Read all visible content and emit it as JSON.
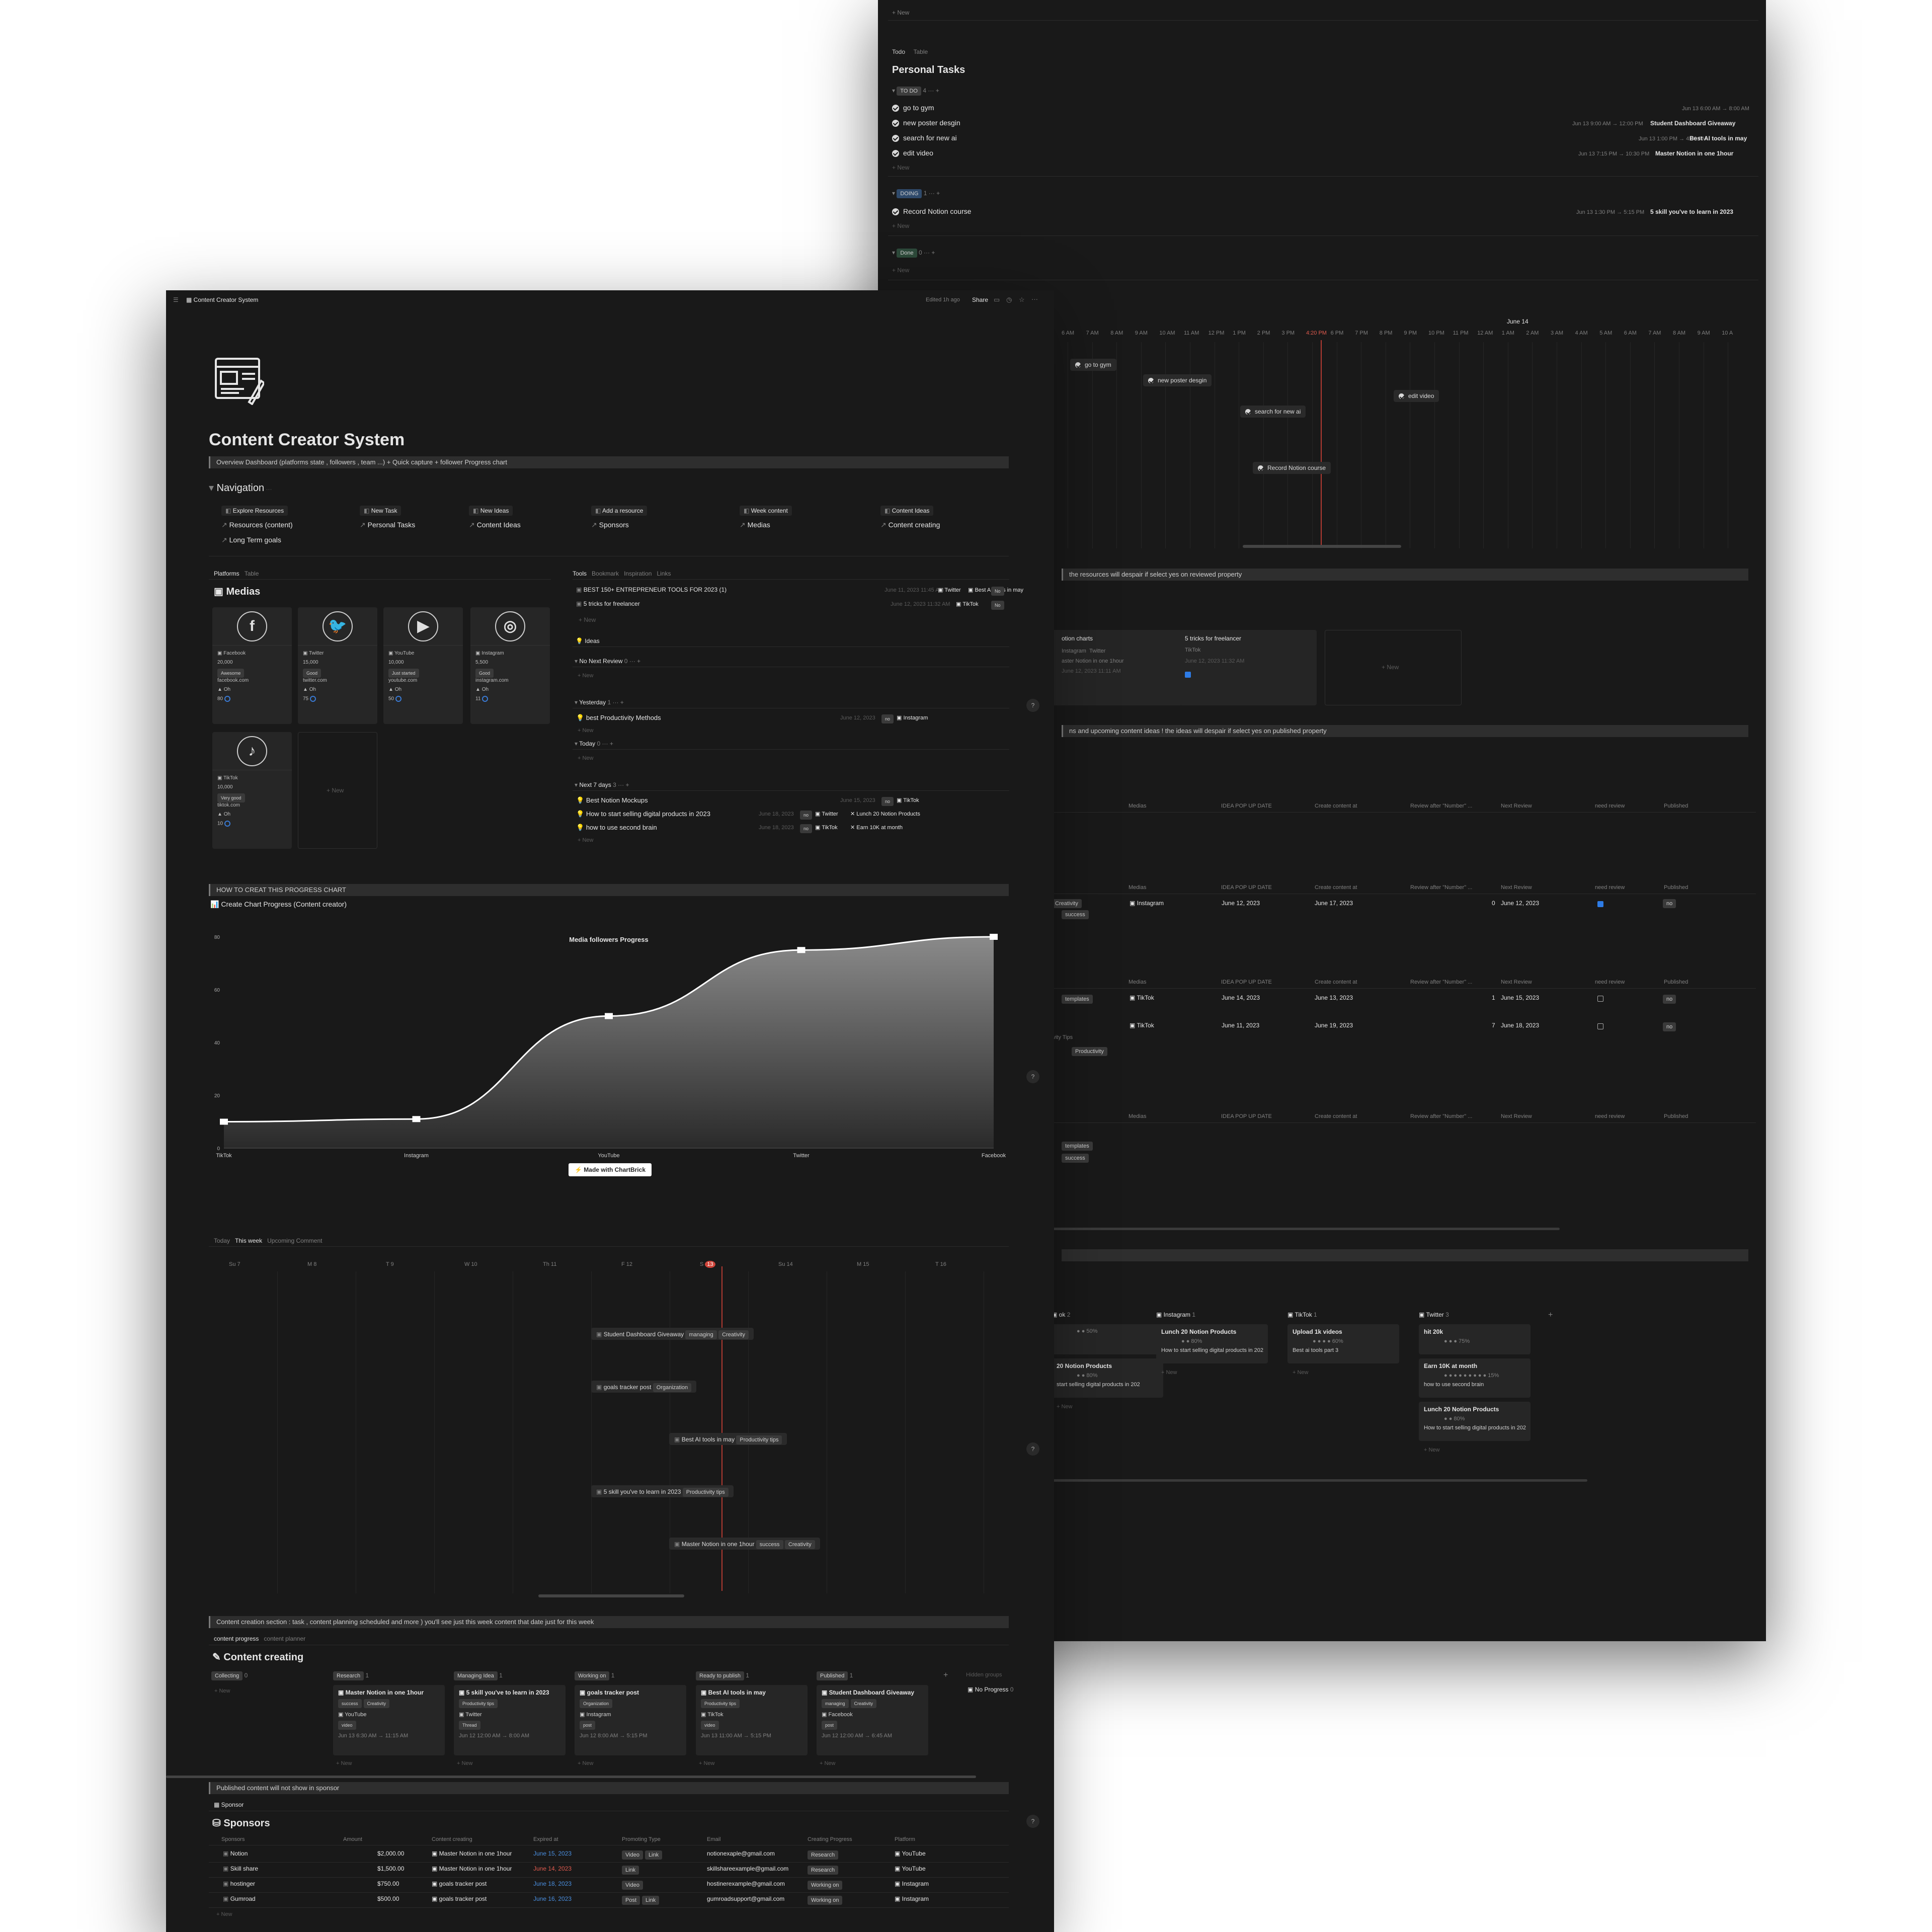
{
  "back": {
    "top_new": "+ New",
    "views": [
      "Todo",
      "Table"
    ],
    "title": "Personal Tasks",
    "groups": [
      {
        "label": "TO DO",
        "count": "4",
        "tasks": [
          {
            "name": "go to gym",
            "date": "Jun 13 6:00 AM → 8:00 AM",
            "rel": ""
          },
          {
            "name": "new poster desgin",
            "date": "Jun 13 9:00 AM → 12:00 PM",
            "rel": "Student Dashboard Giveaway"
          },
          {
            "name": "search for new ai",
            "date": "Jun 13 1:00 PM → 4:00 PM",
            "rel": "Best AI tools in may"
          },
          {
            "name": "edit video",
            "date": "Jun 13 7:15 PM → 10:30 PM",
            "rel": "Master Notion in one 1hour"
          }
        ]
      },
      {
        "label": "DOING",
        "count": "1",
        "tasks": [
          {
            "name": "Record Notion course",
            "date": "Jun 13 1:30 PM → 5:15 PM",
            "rel": "5 skill you've to learn in 2023"
          }
        ]
      },
      {
        "label": "Done",
        "count": "0",
        "tasks": []
      }
    ],
    "new_label": "+ New",
    "timeline_date": "June 14",
    "hours": [
      "6 AM",
      "7 AM",
      "8 AM",
      "9 AM",
      "10 AM",
      "11 AM",
      "12 PM",
      "1 PM",
      "2 PM",
      "3 PM",
      "4:20 PM",
      "6 PM",
      "7 PM",
      "8 PM",
      "9 PM",
      "10 PM",
      "11 PM",
      "12 AM",
      "1 AM",
      "2 AM",
      "3 AM",
      "4 AM",
      "5 AM",
      "6 AM",
      "7 AM",
      "8 AM",
      "9 AM",
      "10 A"
    ],
    "tl_bars": [
      "go to gym",
      "new poster desgin",
      "search for new ai",
      "edit video",
      "Record Notion course"
    ],
    "callout1": "the resources will despair if select yes on reviewed property",
    "res_cards": [
      {
        "title": "otion charts",
        "l1": "Instagram",
        "l2": "Twitter",
        "l3": "aster Notion in one 1hour",
        "l4": "June 12, 2023 11:11 AM"
      },
      {
        "title": "5 tricks for freelancer",
        "l1": "TikTok",
        "l2": "",
        "l3": "",
        "l4": "June 12, 2023 11:32 AM"
      }
    ],
    "res_new": "+ New",
    "callout2": "ns and upcoming content ideas  ! the ideas will despair if select yes on published property",
    "idea_cols": [
      "Medias",
      "IDEA POP UP DATE",
      "Create content at",
      "Review after \"Number\" ...",
      "Next Review",
      "need review",
      "Published"
    ],
    "idea_rows": [
      {
        "media": "Instagram",
        "pop": "June 12, 2023",
        "create": "June 17, 2023",
        "num": "0",
        "next": "June 12, 2023",
        "pub": "no",
        "tags": [
          "Creativity",
          "success"
        ]
      },
      {
        "media": "TikTok",
        "pop": "June 14, 2023",
        "create": "June 13, 2023",
        "num": "1",
        "next": "June 15, 2023",
        "pub": "no",
        "tags": [
          "templates"
        ]
      },
      {
        "media": "TikTok",
        "pop": "June 11, 2023",
        "create": "June 19, 2023",
        "num": "7",
        "next": "June 18, 2023",
        "pub": "no",
        "tags": [
          "ivity Tips",
          "Productivity"
        ]
      }
    ],
    "last_tags": [
      "templates",
      "success"
    ],
    "goal_groups": [
      {
        "name": "ok",
        "count": "2",
        "cards": [
          {
            "t": "",
            "p": "● ● 50%",
            "l": ""
          },
          {
            "t": "20 Notion Products",
            "p": "● ● 80%",
            "l": "start selling digital products in 202"
          }
        ]
      },
      {
        "name": "Instagram",
        "count": "1",
        "cards": [
          {
            "t": "Lunch 20 Notion Products",
            "p": "● ● 80%",
            "l": "How to start selling digital products in 202"
          }
        ]
      },
      {
        "name": "TikTok",
        "count": "1",
        "cards": [
          {
            "t": "Upload 1k videos",
            "p": "● ● ● ● 60%",
            "l": "Best ai tools part 3"
          }
        ]
      },
      {
        "name": "Twitter",
        "count": "3",
        "cards": [
          {
            "t": "hit 20k",
            "p": "● ● ● 75%",
            "l": ""
          },
          {
            "t": "Earn 10K at month",
            "p": "● ● ● ● ● ● ● ● ● 15%",
            "l": "how to use second brain"
          },
          {
            "t": "Lunch 20 Notion Products",
            "p": "● ● 80%",
            "l": "How to start selling digital products in 202"
          }
        ]
      }
    ]
  },
  "front": {
    "breadcrumb": "Content Creator System",
    "edited": "Edited 1h ago",
    "share": "Share",
    "title": "Content Creator System",
    "callout_top": "Overview Dashboard (platforms state , followers , team ...) + Quick capture  + follower Progress chart",
    "nav_title": "Navigation",
    "nav_top": [
      "Explore Resources",
      "New Task",
      "New Ideas",
      "Add a resource",
      "Week content",
      "Content Ideas"
    ],
    "nav_links": [
      "Resources (content)",
      "Personal Tasks",
      "Content Ideas",
      "Sponsors",
      "Medias",
      "Content creating",
      "Long Term goals"
    ],
    "platform_tabs": [
      "Platforms",
      "Table"
    ],
    "medias_title": "Medias",
    "medias": [
      {
        "name": "Facebook",
        "followers": "20,000",
        "status": "Awesome",
        "url": "facebook.com",
        "pct": "Oh",
        "n": "80",
        "glyph": "f"
      },
      {
        "name": "Twitter",
        "followers": "15,000",
        "status": "Good",
        "url": "twitter.com",
        "pct": "Oh",
        "n": "75",
        "glyph": "🐦"
      },
      {
        "name": "YouTube",
        "followers": "10,000",
        "status": "Just started",
        "url": "youtube.com",
        "pct": "Oh",
        "n": "50",
        "glyph": "▶"
      },
      {
        "name": "Instagram",
        "followers": "5,500",
        "status": "Good",
        "url": "instagram.com",
        "pct": "Oh",
        "n": "11",
        "glyph": "◎"
      },
      {
        "name": "TikTok",
        "followers": "10,000",
        "status": "Very good",
        "url": "tiktok.com",
        "pct": "Oh",
        "n": "10",
        "glyph": "♪"
      }
    ],
    "medias_new": "+ New",
    "tool_tabs": [
      "Tools",
      "Bookmark",
      "Inspiration",
      "Links"
    ],
    "tools": [
      {
        "name": "BEST 150+ ENTREPRENEUR TOOLS FOR 2023 (1)",
        "date": "June 11, 2023 11:45 AM",
        "p": "Twitter",
        "rel": "Best AI tools in may",
        "tag": "No"
      },
      {
        "name": "5 tricks for freelancer",
        "date": "June 12, 2023 11:32 AM",
        "p": "TikTok",
        "rel": "",
        "tag": "No"
      }
    ],
    "ideas_tab": "Ideas",
    "idea_groups": [
      {
        "label": "No Next Review",
        "count": "0",
        "items": []
      },
      {
        "label": "Yesterday",
        "count": "1",
        "items": [
          {
            "name": "best Productivity Methods",
            "date": "June 12, 2023",
            "tag": "no",
            "p": "Instagram",
            "rel": ""
          }
        ]
      },
      {
        "label": "Today",
        "count": "0",
        "items": []
      },
      {
        "label": "Next 7 days",
        "count": "3",
        "items": [
          {
            "name": "Best Notion Mockups",
            "date": "June 15, 2023",
            "tag": "no",
            "p": "TikTok",
            "rel": ""
          },
          {
            "name": "How to start selling digital products in 2023",
            "date": "June 18, 2023",
            "tag": "no",
            "p": "Twitter",
            "rel": "Lunch 20 Notion Products"
          },
          {
            "name": "how to use second brain",
            "date": "June 18, 2023",
            "tag": "no",
            "p": "TikTok",
            "rel": "Earn 10K at month"
          }
        ]
      }
    ],
    "new": "+ New",
    "callout_chart": "HOW TO CREAT THIS PROGRESS CHART",
    "chart_link": "Create Chart Progress (Content creator)",
    "madewith": "Made with ChartBrick",
    "week_tabs": [
      "Today",
      "This week",
      "Upcoming Comment"
    ],
    "week_days": [
      "Su 7",
      "M 8",
      "T 9",
      "W 10",
      "Th 11",
      "F 12",
      "S 13",
      "Su 14",
      "M 15",
      "T 16"
    ],
    "week_bars": [
      {
        "name": "Student Dashboard Giveaway",
        "tags": [
          "managing",
          "Creativity"
        ]
      },
      {
        "name": "goals tracker post",
        "tags": [
          "Organization"
        ]
      },
      {
        "name": "Best AI tools in may",
        "tags": [
          "Productivity tips"
        ]
      },
      {
        "name": "5 skill you've to learn in 2023",
        "tags": [
          "Productivity tips"
        ]
      },
      {
        "name": "Master Notion in one 1hour",
        "tags": [
          "success",
          "Creativity"
        ]
      }
    ],
    "callout_cc": "Content creation section : task , content planning scheduled and more ) you'll see just this week content that date just for this week",
    "cc_tabs": [
      "content progress",
      "content planner"
    ],
    "cc_title": "Content creating",
    "board": [
      {
        "name": "Collecting",
        "count": "0",
        "card": null
      },
      {
        "name": "Research",
        "count": "1",
        "card": {
          "t": "Master Notion in one 1hour",
          "tags": [
            "success",
            "Creativity"
          ],
          "p": "YouTube",
          "type": "video",
          "date": "Jun 13 6:30 AM → 11:15 AM"
        }
      },
      {
        "name": "Managing Idea",
        "count": "1",
        "card": {
          "t": "5 skill you've to learn in 2023",
          "tags": [
            "Productivity tips"
          ],
          "p": "Twitter",
          "type": "Thread",
          "date": "Jun 12 12:00 AM → 8:00 AM"
        }
      },
      {
        "name": "Working on",
        "count": "1",
        "card": {
          "t": "goals tracker post",
          "tags": [
            "Organization"
          ],
          "p": "Instagram",
          "type": "post",
          "date": "Jun 12 8:00 AM → 5:15 PM"
        }
      },
      {
        "name": "Ready to publish",
        "count": "1",
        "card": {
          "t": "Best AI tools in may",
          "tags": [
            "Productivity tips"
          ],
          "p": "TikTok",
          "type": "video",
          "date": "Jun 13 11:00 AM → 5:15 PM"
        }
      },
      {
        "name": "Published",
        "count": "1",
        "card": {
          "t": "Student Dashboard Giveaway",
          "tags": [
            "managing",
            "Creativity"
          ],
          "p": "Facebook",
          "type": "post",
          "date": "Jun 12 12:00 AM → 6:45 AM"
        }
      }
    ],
    "hidden_groups": "Hidden groups",
    "no_progress": "No Progress",
    "no_progress_count": "0",
    "callout_sp": "Published content will not show in sponsor",
    "sp_tab": "Sponsor",
    "sp_title": "Sponsors",
    "sp_cols": [
      "Sponsors",
      "Amount",
      "Content creating",
      "Expired at",
      "Promoting Type",
      "Email",
      "Creating Progress",
      "Platform"
    ],
    "sponsors": [
      {
        "name": "Notion",
        "amount": "$2,000.00",
        "content": "Master Notion in one 1hour",
        "exp": "June 15, 2023",
        "red": false,
        "types": [
          "Video",
          "Link"
        ],
        "email": "notionexaple@gmail.com",
        "prog": "Research",
        "plat": "YouTube"
      },
      {
        "name": "Skill share",
        "amount": "$1,500.00",
        "content": "Master Notion in one 1hour",
        "exp": "June 14, 2023",
        "red": true,
        "types": [
          "Link"
        ],
        "email": "skillshareexample@gmail.com",
        "prog": "Research",
        "plat": "YouTube"
      },
      {
        "name": "hostinger",
        "amount": "$750.00",
        "content": "goals tracker post",
        "exp": "June 18, 2023",
        "red": false,
        "types": [
          "Video"
        ],
        "email": "hostinerexample@gmail.com",
        "prog": "Working on",
        "plat": "Instagram"
      },
      {
        "name": "Gumroad",
        "amount": "$500.00",
        "content": "goals tracker post",
        "exp": "June 16, 2023",
        "red": false,
        "types": [
          "Post",
          "Link"
        ],
        "email": "gumroadsupport@gmail.com",
        "prog": "Working on",
        "plat": "Instagram"
      }
    ]
  },
  "colors": {
    "bg": "#191919",
    "card": "#252525",
    "accent_red": "#e05a4e",
    "accent_blue": "#2e7ce6"
  },
  "chart_data": {
    "type": "area",
    "title": "Media followers Progress",
    "categories": [
      "TikTok",
      "Instagram",
      "YouTube",
      "Twitter",
      "Facebook"
    ],
    "series": [
      {
        "values": [
          10,
          11,
          50,
          75,
          80
        ]
      }
    ],
    "ylim": [
      0,
      80
    ],
    "yticks": [
      0,
      20,
      40,
      60,
      80
    ],
    "grid": false,
    "legend": "none",
    "xlabel": "",
    "ylabel": ""
  }
}
